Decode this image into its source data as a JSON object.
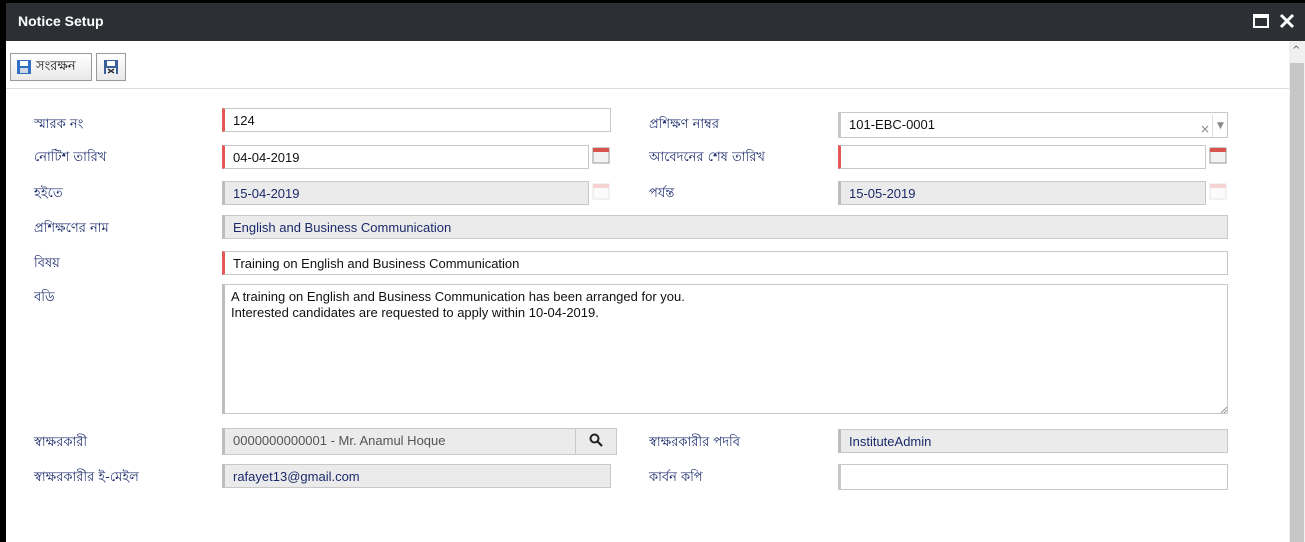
{
  "window": {
    "title": "Notice Setup"
  },
  "toolbar": {
    "save_label": "সংরক্ষন"
  },
  "form": {
    "memo_no": {
      "label": "স্মারক নং",
      "value": "124"
    },
    "training_no": {
      "label": "প্রশিক্ষণ নাম্বর",
      "value": "101-EBC-0001"
    },
    "notice_date": {
      "label": "নোটিশ তারিখ",
      "value": "04-04-2019"
    },
    "application_deadline": {
      "label": "আবেদনের শেষ তারিখ",
      "value": ""
    },
    "from_date": {
      "label": "হইতে",
      "value": "15-04-2019"
    },
    "to_date": {
      "label": "পর্যন্ত",
      "value": "15-05-2019"
    },
    "training_name": {
      "label": "প্রশিক্ষণের নাম",
      "value": "English and Business Communication"
    },
    "subject": {
      "label": "বিষয়",
      "value": "Training on English and Business Communication"
    },
    "body": {
      "label": "বডি",
      "value": "A training on English and Business Communication has been arranged for you.\nInterested candidates are requested to apply within 10-04-2019."
    },
    "signatory": {
      "label": "স্বাক্ষরকারী",
      "value": "0000000000001 - Mr. Anamul Hoque"
    },
    "signatory_designation": {
      "label": "স্বাক্ষরকারীর পদবি",
      "value": "InstituteAdmin"
    },
    "signatory_email": {
      "label": "স্বাক্ষরকারীর ই-মেইল",
      "value": "rafayet13@gmail.com"
    },
    "carbon_copy": {
      "label": "কার্বন কপি",
      "value": ""
    }
  },
  "icons": {
    "maximize": "maximize-icon",
    "close": "close-icon",
    "save": "save-icon",
    "save_close": "save-close-icon",
    "calendar": "calendar-icon",
    "search": "search-icon",
    "clear": "×",
    "dropdown": "▼",
    "scroll_up": "^"
  },
  "colors": {
    "titlebar": "#2c2f33",
    "label": "#1b2a6b",
    "required": "#e45757",
    "readonly_bg": "#ebebeb"
  }
}
